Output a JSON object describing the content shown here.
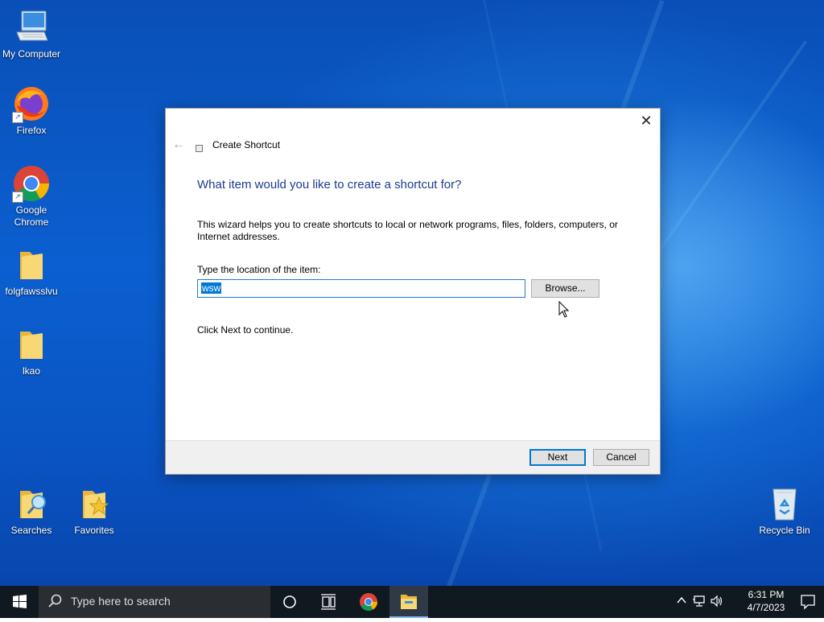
{
  "desktop": {
    "icons": [
      {
        "label": "My Computer",
        "icon": "computer-icon"
      },
      {
        "label": "Firefox",
        "icon": "firefox-icon"
      },
      {
        "label": "Google Chrome",
        "icon": "chrome-icon"
      },
      {
        "label": "folgfawsslvu",
        "icon": "folder-icon"
      },
      {
        "label": "lkao",
        "icon": "folder-icon"
      },
      {
        "label": "Searches",
        "icon": "searches-folder-icon"
      },
      {
        "label": "Favorites",
        "icon": "favorites-folder-icon"
      },
      {
        "label": "Recycle Bin",
        "icon": "recycle-bin-icon"
      }
    ]
  },
  "dialog": {
    "title": "Create Shortcut",
    "heading": "What item would you like to create a shortcut for?",
    "intro": "This wizard helps you to create shortcuts to local or network programs, files, folders, computers, or Internet addresses.",
    "location_label": "Type the location of the item:",
    "location_value": "wsw",
    "browse_label": "Browse...",
    "continue_text": "Click Next to continue.",
    "next_label": "Next",
    "cancel_label": "Cancel",
    "accent_color": "#0078d7",
    "heading_color": "#1c3c8c"
  },
  "taskbar": {
    "search_placeholder": "Type here to search",
    "clock_time": "6:31 PM",
    "clock_date": "4/7/2023",
    "pinned": [
      "cortana-icon",
      "task-view-icon",
      "chrome-icon",
      "file-explorer-icon"
    ],
    "tray": [
      "chevron-up-icon",
      "network-icon",
      "volume-icon"
    ]
  }
}
